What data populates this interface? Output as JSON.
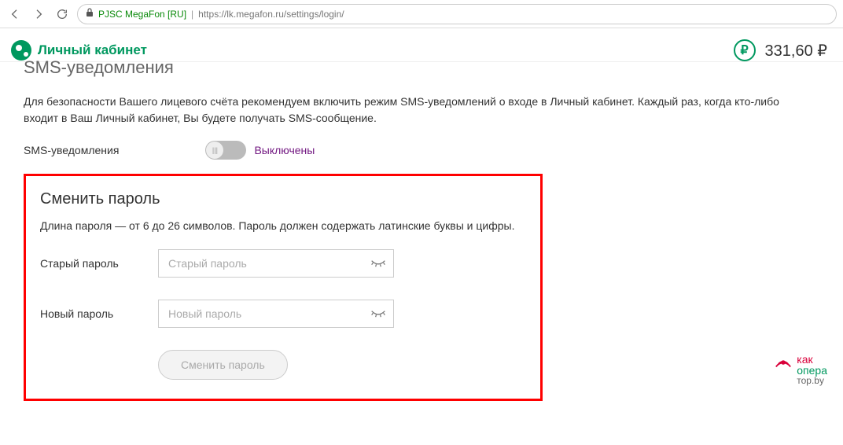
{
  "browser": {
    "cert": "PJSC MegaFon [RU]",
    "url": "https://lk.megafon.ru/settings/login/"
  },
  "header": {
    "brand": "Личный кабинет",
    "balance_symbol": "₽",
    "balance": "331,60 ₽"
  },
  "sms": {
    "title": "SMS-уведомления",
    "desc": "Для безопасности Вашего лицевого счёта рекомендуем включить режим SMS-уведомлений о входе в Личный кабинет. Каждый раз, когда кто-либо входит в Ваш Личный кабинет, Вы будете получать SMS-сообщение.",
    "label": "SMS-уведомления",
    "status": "Выключены",
    "knob_glyph": "|||"
  },
  "password": {
    "title": "Сменить пароль",
    "desc": "Длина пароля — от 6 до 26 символов. Пароль должен содержать латинские буквы и цифры.",
    "old_label": "Старый пароль",
    "old_placeholder": "Старый пароль",
    "new_label": "Новый пароль",
    "new_placeholder": "Новый пароль",
    "submit": "Сменить пароль"
  },
  "watermark": {
    "line1": "как",
    "line2": "опера",
    "line3": "тор.by"
  }
}
